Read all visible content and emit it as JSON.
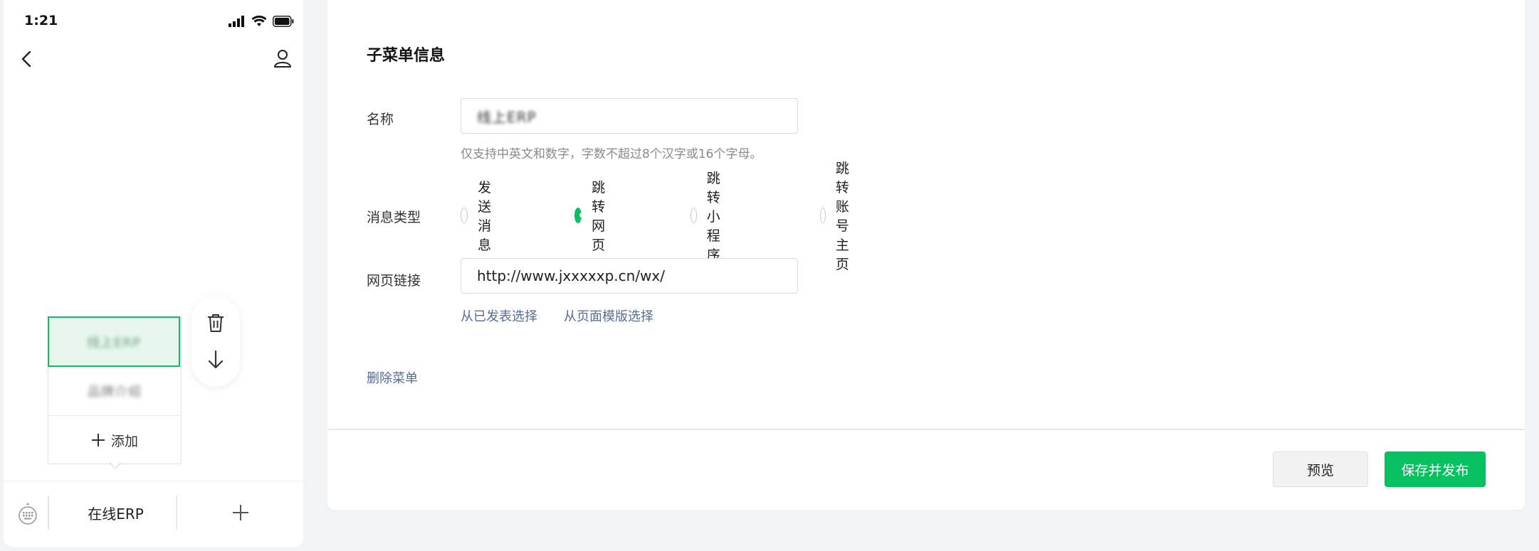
{
  "status_bar": {
    "time": "1:21"
  },
  "phone": {
    "submenu": {
      "items": [
        {
          "label": "线上ERP",
          "state": "selected"
        },
        {
          "label": "品牌介绍"
        }
      ],
      "add_label": "添加"
    },
    "menubar": {
      "item_label": "在线ERP"
    }
  },
  "editor": {
    "section_title": "子菜单信息",
    "name": {
      "label": "名称",
      "value": "线上ERP",
      "hint": "仅支持中英文和数字，字数不超过8个汉字或16个字母。"
    },
    "message_type": {
      "label": "消息类型",
      "options": [
        "发送消息",
        "跳转网页",
        "跳转小程序",
        "跳转账号主页"
      ],
      "selected": "跳转网页"
    },
    "url": {
      "label": "网页链接",
      "value": "http://www.jxxxxxp.cn/wx/",
      "links": [
        "从已发表选择",
        "从页面模版选择"
      ]
    },
    "delete_label": "删除菜单",
    "buttons": {
      "preview": "预览",
      "publish": "保存并发布"
    }
  },
  "colors": {
    "accent": "#07c160",
    "link": "#576b95"
  }
}
